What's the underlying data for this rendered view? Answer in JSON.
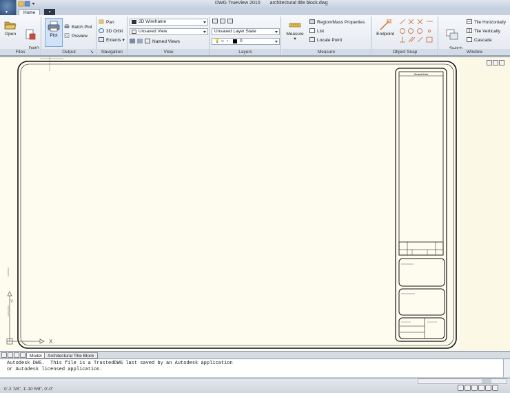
{
  "window": {
    "app_title": "DWG TrueView 2010",
    "doc_title": "architectural title block.dwg"
  },
  "tabs": {
    "home": "Home"
  },
  "ribbon": {
    "files": {
      "title": "Files",
      "open": "Open",
      "dwg_convert": "DWG\nConvert"
    },
    "output": {
      "title": "Output",
      "plot": "Plot",
      "batch_plot": "Batch Plot",
      "preview": "Preview"
    },
    "navigation": {
      "title": "Navigation",
      "pan": "Pan",
      "orbit": "3D Orbit",
      "extents": "Extents"
    },
    "view": {
      "title": "View",
      "visual_style": "2D Wireframe",
      "named_view": "Unsaved View",
      "named_views": "Named Views"
    },
    "layers": {
      "title": "Layers",
      "layer_state": "Unsaved Layer State",
      "current_layer": "0"
    },
    "measure": {
      "title": "Measure",
      "measure": "Measure",
      "region_mass": "Region/Mass Properties",
      "list": "List",
      "locate_point": "Locate Point"
    },
    "object_snap": {
      "title": "Object Snap",
      "endpoint": "Endpoint"
    },
    "window_panel": {
      "title": "Window",
      "switch_windows": "Switch\nWindows",
      "tile_horizontally": "Tile Horizontally",
      "tile_vertically": "Tile Vertically",
      "cascade": "Cascade"
    }
  },
  "drawing": {
    "general_notes": "General Notes",
    "ucs_y": "Y",
    "ucs_x": "X"
  },
  "layout_tabs": {
    "model": "Model",
    "title_block": "Architectural Title Block"
  },
  "command_line": {
    "line1": "Autodesk DWG.  This file is a TrustedDWG last saved by an Autodesk application",
    "line2": "or Autodesk licensed application."
  },
  "status": {
    "coords": "0'-2 7/8\",   1'-10 5/8\",   0'-0\""
  },
  "colors": {
    "canvas": "#fefcef",
    "ribbon": "#e8edf3",
    "accent": "#2a4a78"
  }
}
